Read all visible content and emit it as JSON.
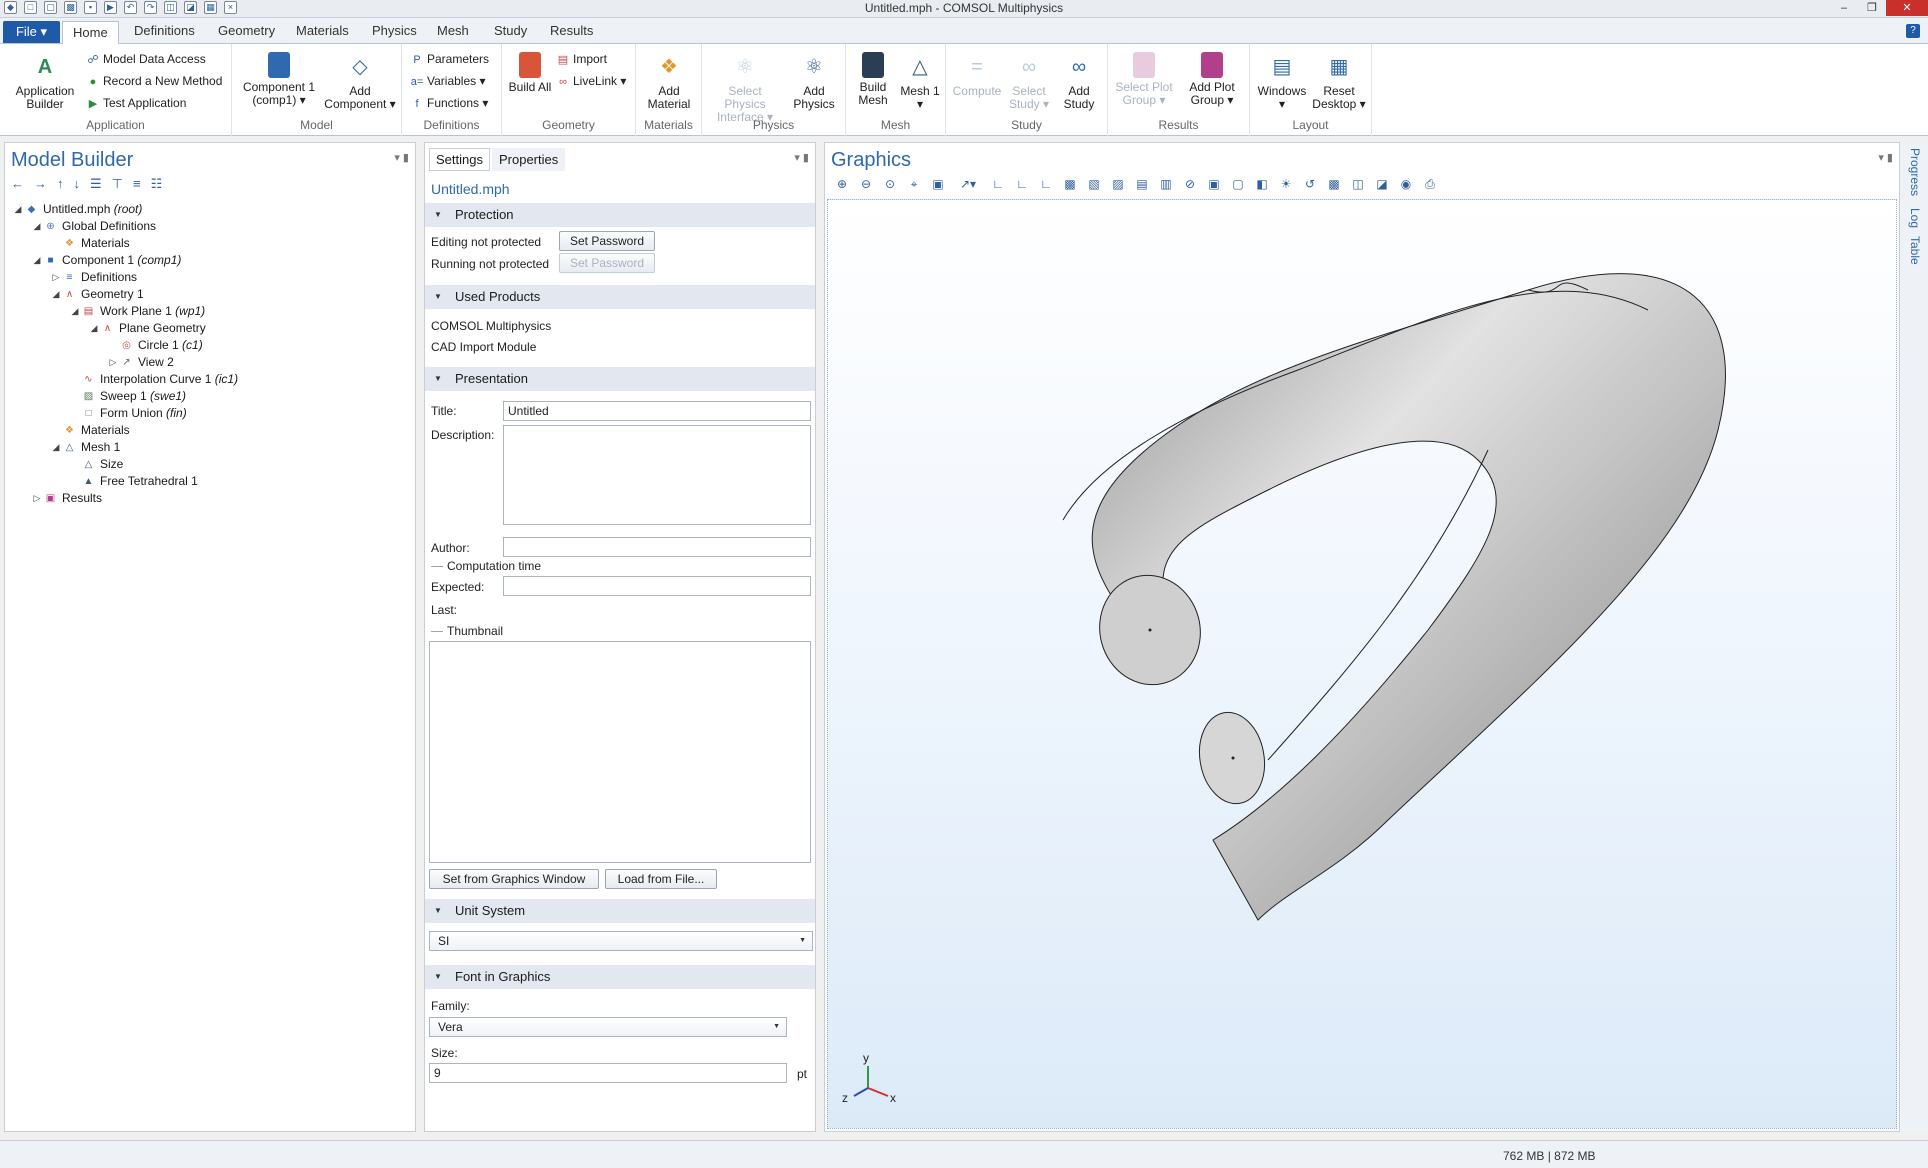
{
  "window": {
    "title": "Untitled.mph - COMSOL Multiphysics",
    "qat_icons": [
      "app-icon",
      "new-icon",
      "open-icon",
      "save-icon",
      "save-as-icon",
      "run-icon",
      "undo-icon",
      "redo-icon",
      "copy-icon",
      "paste-icon",
      "duplicate-icon",
      "delete-icon",
      "zoom-icon",
      "clear-icon",
      "customize-icon"
    ]
  },
  "ribbon": {
    "file_label": "File ▾",
    "tabs": [
      "Home",
      "Definitions",
      "Geometry",
      "Materials",
      "Physics",
      "Mesh",
      "Study",
      "Results"
    ],
    "active_tab": "Home",
    "groups": {
      "application": {
        "label": "Application",
        "app_builder": "Application Builder",
        "model_data_access": "Model Data Access",
        "record_method": "Record a New Method",
        "test_application": "Test Application"
      },
      "model": {
        "label": "Model",
        "component": "Component 1 (comp1) ▾",
        "add_component": "Add Component ▾"
      },
      "definitions": {
        "label": "Definitions",
        "parameters": "Parameters",
        "variables": "Variables ▾",
        "functions": "Functions ▾"
      },
      "geometry": {
        "label": "Geometry",
        "build_all": "Build All",
        "import": "Import",
        "livelink": "LiveLink ▾"
      },
      "materials": {
        "label": "Materials",
        "add_material": "Add Material"
      },
      "physics": {
        "label": "Physics",
        "select_physics": "Select Physics Interface ▾",
        "add_physics": "Add Physics"
      },
      "mesh": {
        "label": "Mesh",
        "build_mesh": "Build Mesh",
        "mesh1": "Mesh 1 ▾"
      },
      "study": {
        "label": "Study",
        "compute": "Compute",
        "select_study": "Select Study ▾",
        "add_study": "Add Study"
      },
      "results": {
        "label": "Results",
        "select_plot_group": "Select Plot Group ▾",
        "add_plot_group": "Add Plot Group ▾"
      },
      "layout": {
        "label": "Layout",
        "windows": "Windows ▾",
        "reset_desktop": "Reset Desktop ▾"
      }
    }
  },
  "model_builder": {
    "title": "Model Builder",
    "tree": [
      {
        "label": "Untitled.mph",
        "tag": "(root)",
        "level": 0,
        "arrow": "◢",
        "icon": "◆",
        "color": "#3b6fb0"
      },
      {
        "label": "Global Definitions",
        "tag": "",
        "level": 1,
        "arrow": "◢",
        "icon": "⊕",
        "color": "#4a79b5"
      },
      {
        "label": "Materials",
        "tag": "",
        "level": 2,
        "arrow": "",
        "icon": "❖",
        "color": "#e0982d"
      },
      {
        "label": "Component 1",
        "tag": "(comp1)",
        "level": 1,
        "arrow": "◢",
        "icon": "■",
        "color": "#2f6ab0"
      },
      {
        "label": "Definitions",
        "tag": "",
        "level": 2,
        "arrow": "▷",
        "icon": "≡",
        "color": "#2f6ab0"
      },
      {
        "label": "Geometry 1",
        "tag": "",
        "level": 2,
        "arrow": "◢",
        "icon": "∧",
        "color": "#c44848"
      },
      {
        "label": "Work Plane 1",
        "tag": "(wp1)",
        "level": 3,
        "arrow": "◢",
        "icon": "▤",
        "color": "#c44848"
      },
      {
        "label": "Plane Geometry",
        "tag": "",
        "level": 4,
        "arrow": "◢",
        "icon": "∧",
        "color": "#c44848"
      },
      {
        "label": "Circle 1",
        "tag": "(c1)",
        "level": 5,
        "arrow": "",
        "icon": "◎",
        "color": "#c44848"
      },
      {
        "label": "View 2",
        "tag": "",
        "level": 5,
        "arrow": "▷",
        "icon": "↗",
        "color": "#666"
      },
      {
        "label": "Interpolation Curve 1",
        "tag": "(ic1)",
        "level": 3,
        "arrow": "",
        "icon": "∿",
        "color": "#c44848"
      },
      {
        "label": "Sweep 1",
        "tag": "(swe1)",
        "level": 3,
        "arrow": "",
        "icon": "▨",
        "color": "#5a7a5a"
      },
      {
        "label": "Form Union",
        "tag": "(fin)",
        "level": 3,
        "arrow": "",
        "icon": "□",
        "color": "#777"
      },
      {
        "label": "Materials",
        "tag": "",
        "level": 2,
        "arrow": "",
        "icon": "❖",
        "color": "#e0982d"
      },
      {
        "label": "Mesh 1",
        "tag": "",
        "level": 2,
        "arrow": "◢",
        "icon": "△",
        "color": "#3b5a80"
      },
      {
        "label": "Size",
        "tag": "",
        "level": 3,
        "arrow": "",
        "icon": "△",
        "color": "#3b5a80"
      },
      {
        "label": "Free Tetrahedral 1",
        "tag": "",
        "level": 3,
        "arrow": "",
        "icon": "▲",
        "color": "#3b5a80"
      },
      {
        "label": "Results",
        "tag": "",
        "level": 1,
        "arrow": "▷",
        "icon": "▣",
        "color": "#b0408a"
      }
    ]
  },
  "settings": {
    "tabs": [
      "Settings",
      "Properties"
    ],
    "filename": "Untitled.mph",
    "protection": {
      "header": "Protection",
      "editing": "Editing not protected",
      "running": "Running not protected",
      "set_password": "Set Password"
    },
    "used_products": {
      "header": "Used Products",
      "items": [
        "COMSOL Multiphysics",
        "CAD Import Module"
      ]
    },
    "presentation": {
      "header": "Presentation",
      "title_label": "Title:",
      "title_value": "Untitled",
      "description_label": "Description:",
      "author_label": "Author:",
      "computation_time": "Computation time",
      "expected_label": "Expected:",
      "last_label": "Last:",
      "thumbnail": "Thumbnail",
      "set_from_graphics": "Set from Graphics Window",
      "load_from_file": "Load from File..."
    },
    "unit_system": {
      "header": "Unit System",
      "value": "SI"
    },
    "font": {
      "header": "Font in Graphics",
      "family_label": "Family:",
      "family_value": "Vera",
      "size_label": "Size:",
      "size_value": "9",
      "size_unit": "pt"
    }
  },
  "graphics": {
    "title": "Graphics",
    "toolbar_icons": [
      "zoom-in-icon",
      "zoom-out-icon",
      "zoom-box-icon",
      "zoom-selected-icon",
      "zoom-extents-icon",
      "axes-icon",
      "xy-view-icon",
      "yz-view-icon",
      "zx-view-icon",
      "select-icon",
      "select-domains-icon",
      "select-boundaries-icon",
      "select-edges-icon",
      "select-points-icon",
      "hide-icon",
      "show-icon",
      "wireframe-icon",
      "transparency-icon",
      "scene-light-icon",
      "reset-icon",
      "render-icon",
      "clip-icon",
      "copy-icon",
      "screenshot-icon",
      "print-icon"
    ],
    "axes": {
      "x": "x",
      "y": "y",
      "z": "z"
    },
    "shape_colors": {
      "surface": "#b9b9b9",
      "face": "#d4d4d4",
      "edge": "#202020"
    }
  },
  "side_tabs": [
    "Progress",
    "Log",
    "Table"
  ],
  "status": {
    "memory": "762 MB | 872 MB"
  }
}
